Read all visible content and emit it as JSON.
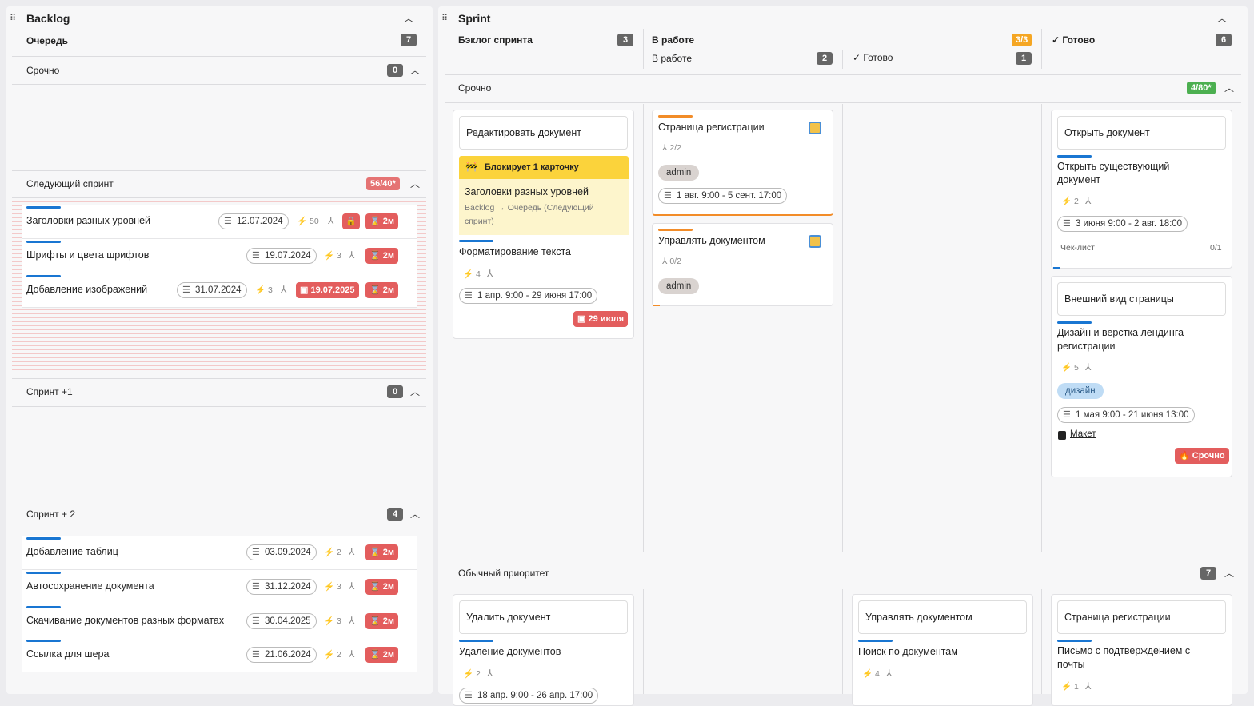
{
  "backlog": {
    "title": "Backlog",
    "queue_label": "Очередь",
    "queue_count": "7",
    "sections": [
      {
        "label": "Срочно",
        "count": "0"
      },
      {
        "label": "Следующий спринт",
        "count": "56/40*"
      },
      {
        "label": "Спринт +1",
        "count": "0"
      },
      {
        "label": "Спринт + 2",
        "count": "4"
      }
    ],
    "next_sprint_rows": [
      {
        "title": "Заголовки разных уровней",
        "date": "12.07.2024",
        "points": "50",
        "time": "2м"
      },
      {
        "title": "Шрифты и цвета шрифтов",
        "date": "19.07.2024",
        "points": "3",
        "time": "2м"
      },
      {
        "title": "Добавление изображений",
        "date": "31.07.2024",
        "points": "3",
        "deadline": "19.07.2025",
        "time": "2м"
      }
    ],
    "sprint2_rows": [
      {
        "title": "Добавление таблиц",
        "date": "03.09.2024",
        "points": "2",
        "time": "2м"
      },
      {
        "title": "Автосохранение документа",
        "date": "31.12.2024",
        "points": "3",
        "time": "2м"
      },
      {
        "title": "Скачивание документов разных форматах",
        "date": "30.04.2025",
        "points": "3",
        "time": "2м"
      },
      {
        "title": "Ссылка для шера",
        "date": "21.06.2024",
        "points": "2",
        "time": "2м"
      }
    ]
  },
  "sprint": {
    "title": "Sprint",
    "columns": {
      "backlog": {
        "label": "Бэклог спринта",
        "count": "3"
      },
      "in_work": {
        "label": "В работе",
        "count": "3/3"
      },
      "in_work_sub": {
        "label": "В работе",
        "count": "2"
      },
      "done_sub": {
        "label": "Готово",
        "count": "1"
      },
      "done": {
        "label": "Готово",
        "count": "6"
      }
    },
    "lanes": [
      {
        "label": "Срочно",
        "count": "4/80*"
      },
      {
        "label": "Обычный приоритет",
        "count": "7"
      }
    ],
    "card1": {
      "parent": "Редактировать документ",
      "blocker": "Блокирует 1 карточку",
      "blocked_title": "Заголовки разных уровней",
      "blocked_path": "Backlog → Очередь (Следующий спринт)",
      "title": "Форматирование текста",
      "points": "4",
      "period": "1 апр. 9:00 - 29 июня 17:00",
      "deadline": "29 июля"
    },
    "card2": {
      "title": "Страница регистрации",
      "subtasks": "2/2",
      "tag": "admin",
      "period": "1 авг. 9:00 - 5 сент. 17:00"
    },
    "card3": {
      "title": "Управлять документом",
      "subtasks": "0/2",
      "tag": "admin"
    },
    "card4": {
      "parent": "Открыть документ",
      "title": "Открыть существующий документ",
      "points": "2",
      "period": "3 июня 9:00 - 2 авг. 18:00",
      "checklist": "Чек-лист",
      "checklist_count": "0/1"
    },
    "card5": {
      "parent": "Внешний вид страницы",
      "title": "Дизайн и верстка лендинга регистрации",
      "points": "5",
      "tag": "дизайн",
      "period": "1 мая 9:00 - 21 июня 13:00",
      "link": "Макет",
      "urgent": "Срочно"
    },
    "card6": {
      "parent": "Удалить документ",
      "title": "Удаление документов",
      "points": "2",
      "period": "18 апр. 9:00 - 26 апр. 17:00"
    },
    "card7": {
      "parent": "Управлять документом",
      "title": "Поиск по документам",
      "points": "4"
    },
    "card8": {
      "parent": "Страница регистрации",
      "title": "Письмо с подтверждением с почты",
      "points": "1"
    }
  }
}
